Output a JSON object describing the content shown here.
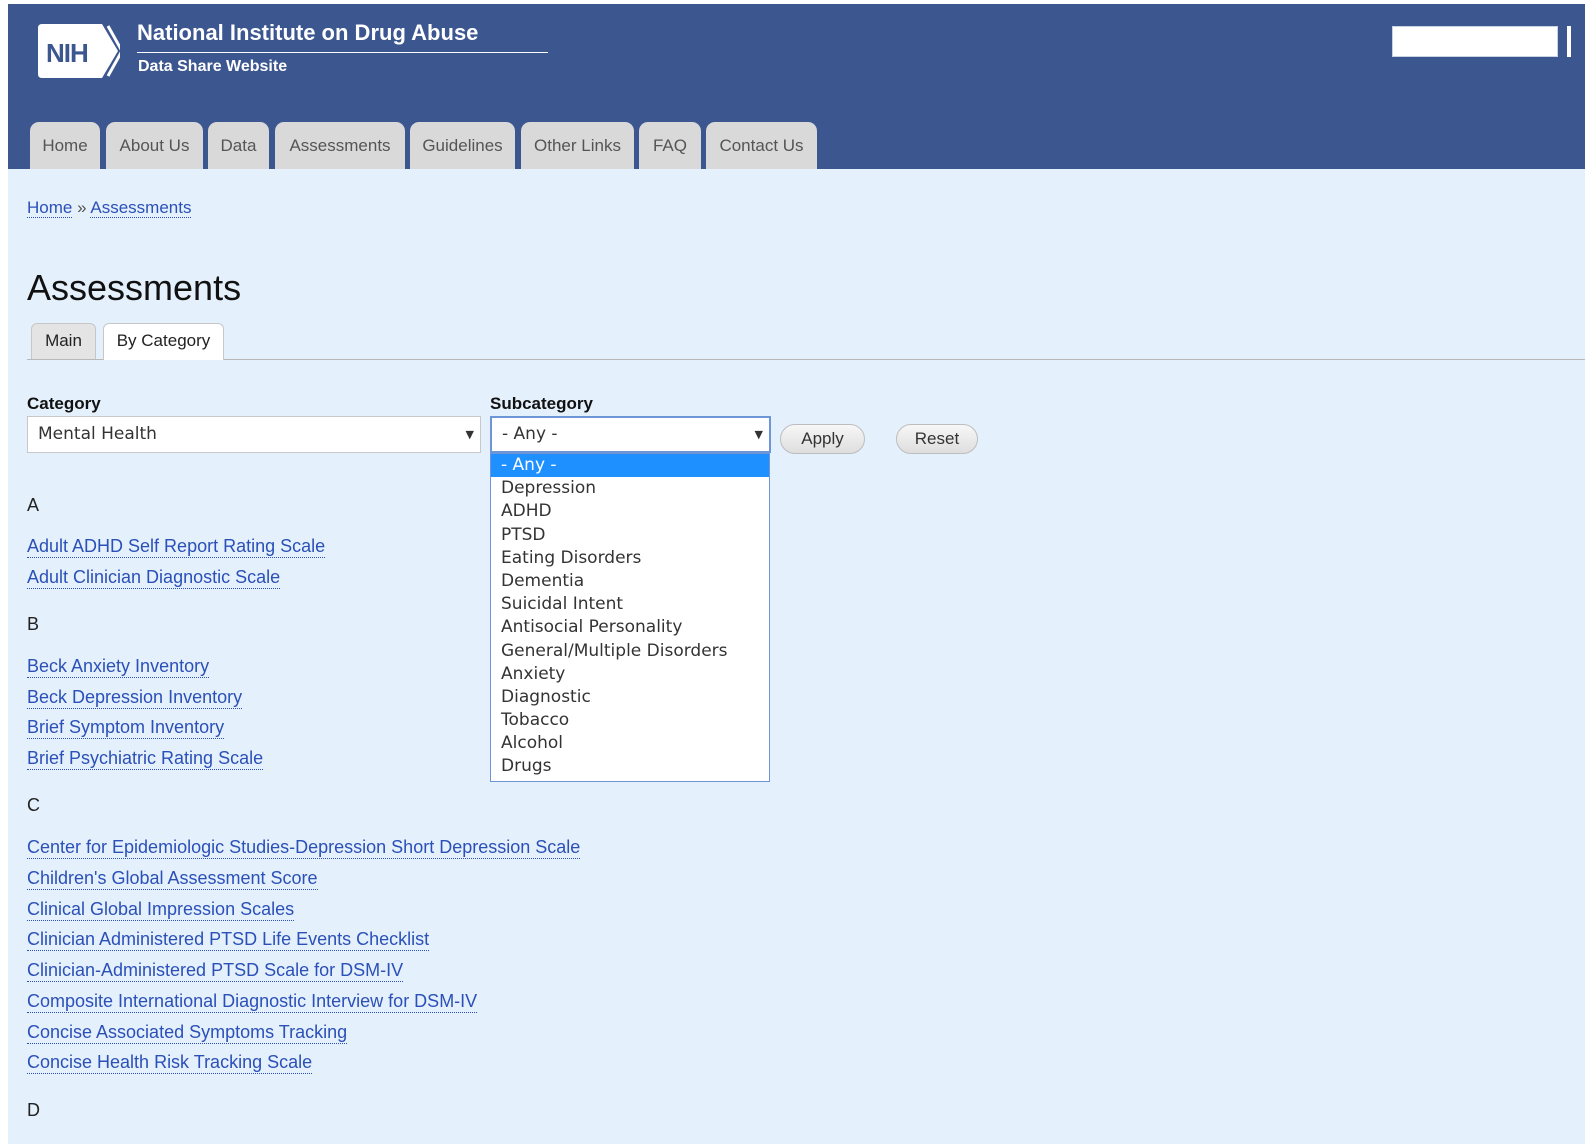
{
  "header": {
    "logo_text": "NIH",
    "title": "National Institute on Drug Abuse",
    "subtitle": "Data Share Website"
  },
  "nav": {
    "tabs": [
      "Home",
      "About Us",
      "Data",
      "Assessments",
      "Guidelines",
      "Other Links",
      "FAQ",
      "Contact Us"
    ]
  },
  "breadcrumb": {
    "home": "Home",
    "separator": "»",
    "current": "Assessments"
  },
  "page": {
    "title": "Assessments",
    "tabs": [
      "Main",
      "By Category"
    ],
    "active_tab": "By Category"
  },
  "filters": {
    "category_label": "Category",
    "category_value": "Mental Health",
    "subcategory_label": "Subcategory",
    "subcategory_value": "- Any -",
    "apply_label": "Apply",
    "reset_label": "Reset",
    "subcategory_options": [
      "- Any -",
      "Depression",
      "ADHD",
      "PTSD",
      "Eating Disorders",
      "Dementia",
      "Suicidal Intent",
      "Antisocial Personality",
      "General/Multiple Disorders",
      "Anxiety",
      "Diagnostic",
      "Tobacco",
      "Alcohol",
      "Drugs"
    ],
    "highlighted_option": "- Any -"
  },
  "groups": [
    {
      "letter": "A",
      "items": [
        "Adult ADHD Self Report Rating Scale",
        "Adult Clinician Diagnostic Scale"
      ]
    },
    {
      "letter": "B",
      "items": [
        "Beck Anxiety Inventory",
        "Beck Depression Inventory",
        "Brief Symptom Inventory",
        "Brief Psychiatric Rating Scale"
      ]
    },
    {
      "letter": "C",
      "items": [
        "Center for Epidemiologic Studies-Depression Short Depression Scale",
        "Children's Global Assessment Score",
        "Clinical Global Impression Scales",
        "Clinician Administered PTSD Life Events Checklist",
        "Clinician-Administered PTSD Scale for DSM-IV",
        "Composite International Diagnostic Interview for DSM-IV",
        "Concise Associated Symptoms Tracking",
        "Concise Health Risk Tracking Scale"
      ]
    },
    {
      "letter": "D",
      "items": []
    }
  ],
  "colors": {
    "header_bg": "#3c5690",
    "page_bg": "#e4f0fb",
    "link": "#2b50b8",
    "dropdown_highlight": "#1e90ff"
  }
}
